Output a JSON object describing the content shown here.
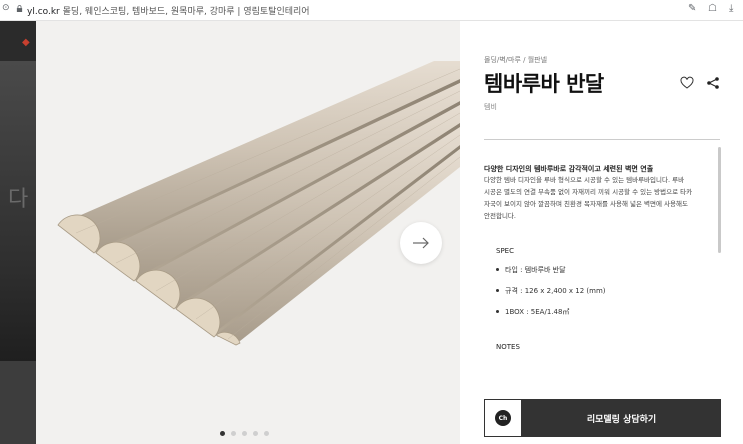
{
  "browser": {
    "domain": "yl.co.kr",
    "page_title": "몰딩, 웨인스코팅, 템바보드, 원목마루, 강마루 | 영림토탈인테리어",
    "nav_glyph": "⊙",
    "icons": [
      "lock-icon",
      "translate-icon",
      "extensions-icon",
      "download-icon"
    ]
  },
  "background_site": {
    "text": "다"
  },
  "gallery": {
    "image_description_icon": "fluted-panel-image",
    "slide_count": 5,
    "active_slide": 1
  },
  "product": {
    "breadcrumb": "몰딩/벽/마루 / 월판넬",
    "title": "템바루바 반달",
    "brand": "템비",
    "description_heading": "다양한 디자인의 템바루바로 감각적이고 세련된 벽면 연출",
    "description_lines": [
      "다양한 템바 디자인을 루바 형식으로 시공할 수 있는 템바루바입니다. 루바",
      "시공은 별도의 연결 부속품 없이 자재끼리 끼워 시공할 수 있는 방법으로 타카",
      "자국이 보이지 않아 깔끔하며 친환경 목자재를 사용해 넓은 벽면에 사용해도",
      "안전합니다."
    ],
    "spec_title": "SPEC",
    "specs": [
      "타입 : 템바루바 반달",
      "규격 : 126 x 2,400 x 12 (mm)",
      "1BOX : 5EA/1.48㎡"
    ],
    "notes_title": "NOTES",
    "cta_icon_text": "Ch",
    "cta_label": "리모델링 상담하기"
  },
  "colors": {
    "accent": "#333333",
    "panel_bg": "#f2f1ef",
    "wood": "#c7bdaf"
  }
}
